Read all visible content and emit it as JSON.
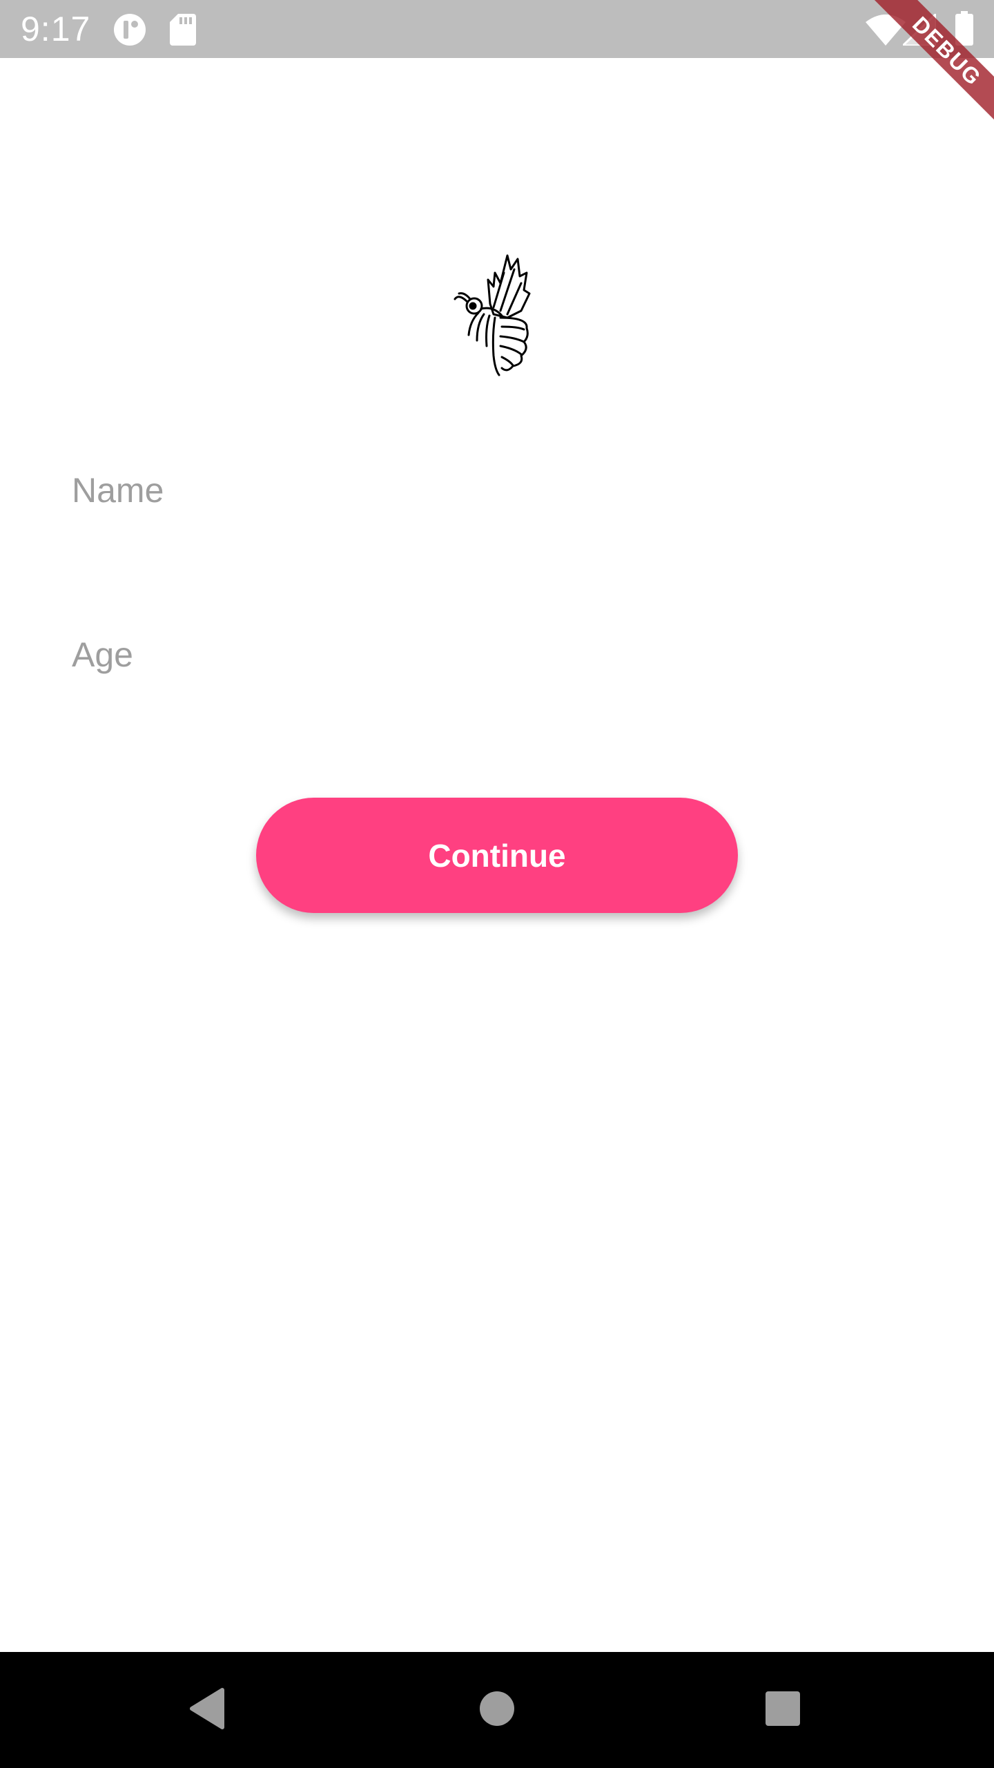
{
  "status_bar": {
    "time": "9:17",
    "icons": [
      "notification-app-icon",
      "sd-card-icon",
      "wifi-icon",
      "cell-signal-icon",
      "battery-icon"
    ]
  },
  "debug_banner": {
    "label": "DEBUG"
  },
  "logo": {
    "icon": "bee-logo-icon"
  },
  "form": {
    "name_placeholder": "Name",
    "name_value": "",
    "age_placeholder": "Age",
    "age_value": ""
  },
  "continue_button": {
    "label": "Continue",
    "color": "#ff4081"
  },
  "nav_bar": {
    "icons": [
      "back-icon",
      "home-icon",
      "recents-icon"
    ]
  }
}
